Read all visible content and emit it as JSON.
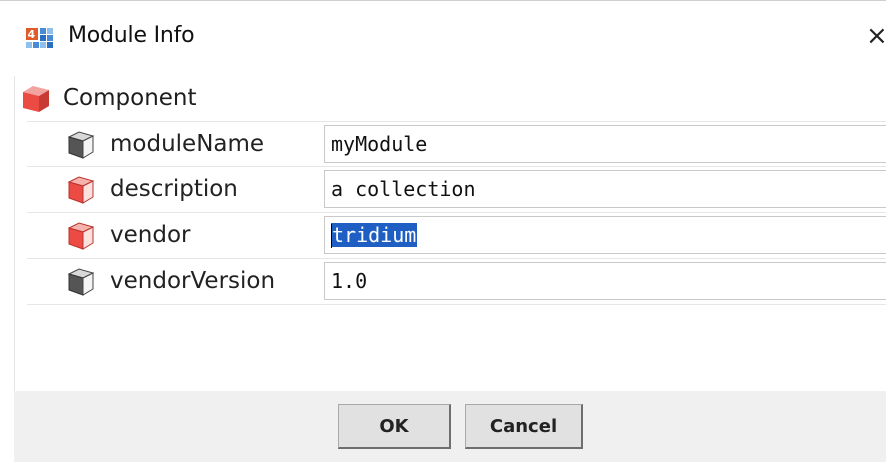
{
  "window": {
    "title": "Module Info",
    "app_icon": "niagara-app-icon",
    "close_glyph": "×"
  },
  "tree": {
    "root_label": "Component",
    "root_icon": "red-component-cube-icon"
  },
  "properties": [
    {
      "label": "moduleName",
      "value": "myModule",
      "icon": "gray-slot-cube-icon"
    },
    {
      "label": "description",
      "value": "a collection",
      "icon": "red-component-cube-icon"
    },
    {
      "label": "vendor",
      "value": "tridium",
      "icon": "red-component-cube-icon",
      "selected": true
    },
    {
      "label": "vendorVersion",
      "value": "1.0",
      "icon": "gray-slot-cube-icon"
    }
  ],
  "buttons": {
    "ok": "OK",
    "cancel": "Cancel"
  },
  "colors": {
    "selection": "#1f5fc4",
    "component_red": "#e8463f",
    "slot_gray": "#6b6b6b"
  }
}
